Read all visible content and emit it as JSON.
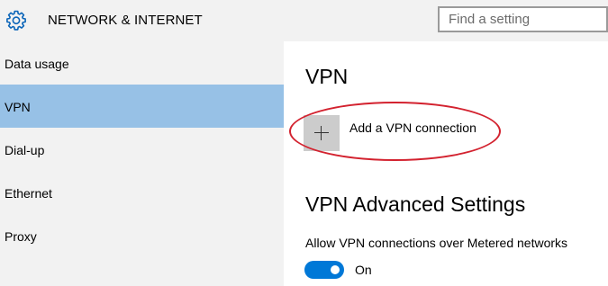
{
  "header": {
    "icon": "gear-icon",
    "title": "NETWORK & INTERNET",
    "search": {
      "placeholder": "Find a setting",
      "value": ""
    }
  },
  "sidebar": {
    "items": [
      {
        "label": "Data usage",
        "selected": false
      },
      {
        "label": "VPN",
        "selected": true
      },
      {
        "label": "Dial-up",
        "selected": false
      },
      {
        "label": "Ethernet",
        "selected": false
      },
      {
        "label": "Proxy",
        "selected": false
      }
    ]
  },
  "main": {
    "vpn_heading": "VPN",
    "add_vpn": {
      "icon": "plus-icon",
      "label": "Add a VPN connection"
    },
    "advanced_heading": "VPN Advanced Settings",
    "metered": {
      "label": "Allow VPN connections over Metered networks",
      "on": true,
      "state_text": "On"
    }
  },
  "colors": {
    "accent": "#0078d7",
    "selected_nav": "#97c1e6",
    "annotation": "#d3222f",
    "sidebar_bg": "#f2f2f2"
  }
}
